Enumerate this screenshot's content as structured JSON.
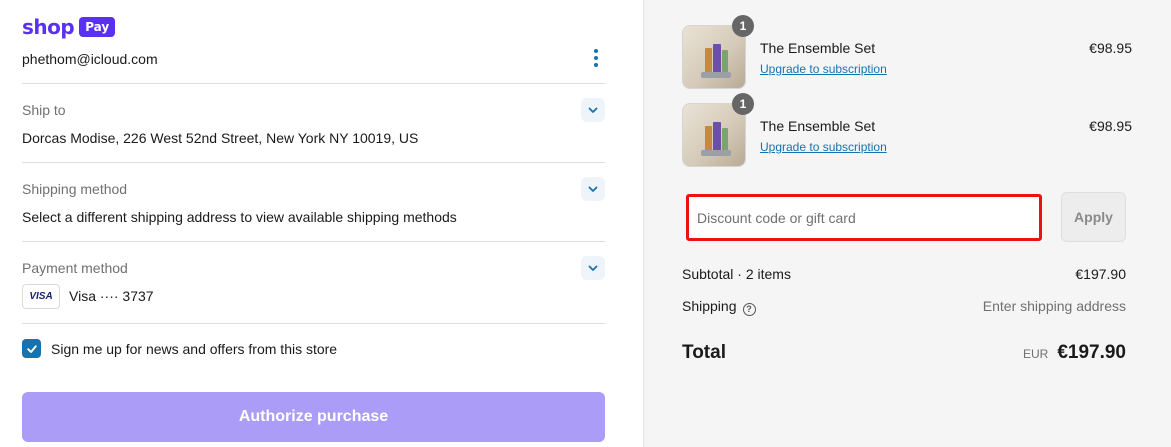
{
  "brand": {
    "shop": "shop",
    "pay": "Pay",
    "color": "#5a31f4"
  },
  "account": {
    "email": "phethom@icloud.com"
  },
  "sections": {
    "ship_to": {
      "label": "Ship to",
      "value": "Dorcas Modise, 226 West 52nd Street, New York NY 10019, US"
    },
    "shipping_method": {
      "label": "Shipping method",
      "value": "Select a different shipping address to view available shipping methods"
    },
    "payment_method": {
      "label": "Payment method",
      "card_brand": "VISA",
      "card_text": "Visa ···· 3737"
    }
  },
  "newsletter": {
    "label": "Sign me up for news and offers from this store",
    "checked": true
  },
  "actions": {
    "authorize_label": "Authorize purchase"
  },
  "cart": {
    "items": [
      {
        "name": "The Ensemble Set",
        "quantity": "1",
        "link": "Upgrade to subscription",
        "price": "€98.95"
      },
      {
        "name": "The Ensemble Set",
        "quantity": "1",
        "link": "Upgrade to subscription",
        "price": "€98.95"
      }
    ],
    "discount": {
      "placeholder": "Discount code or gift card",
      "apply_label": "Apply"
    },
    "subtotal": {
      "label": "Subtotal · 2 items",
      "value": "€197.90"
    },
    "shipping": {
      "label": "Shipping",
      "value": "Enter shipping address"
    },
    "total": {
      "label": "Total",
      "currency": "EUR",
      "value": "€197.90"
    }
  },
  "colors": {
    "accent": "#1773b0",
    "highlight": "#ee1111",
    "button_disabled": "#ab9cf7"
  }
}
